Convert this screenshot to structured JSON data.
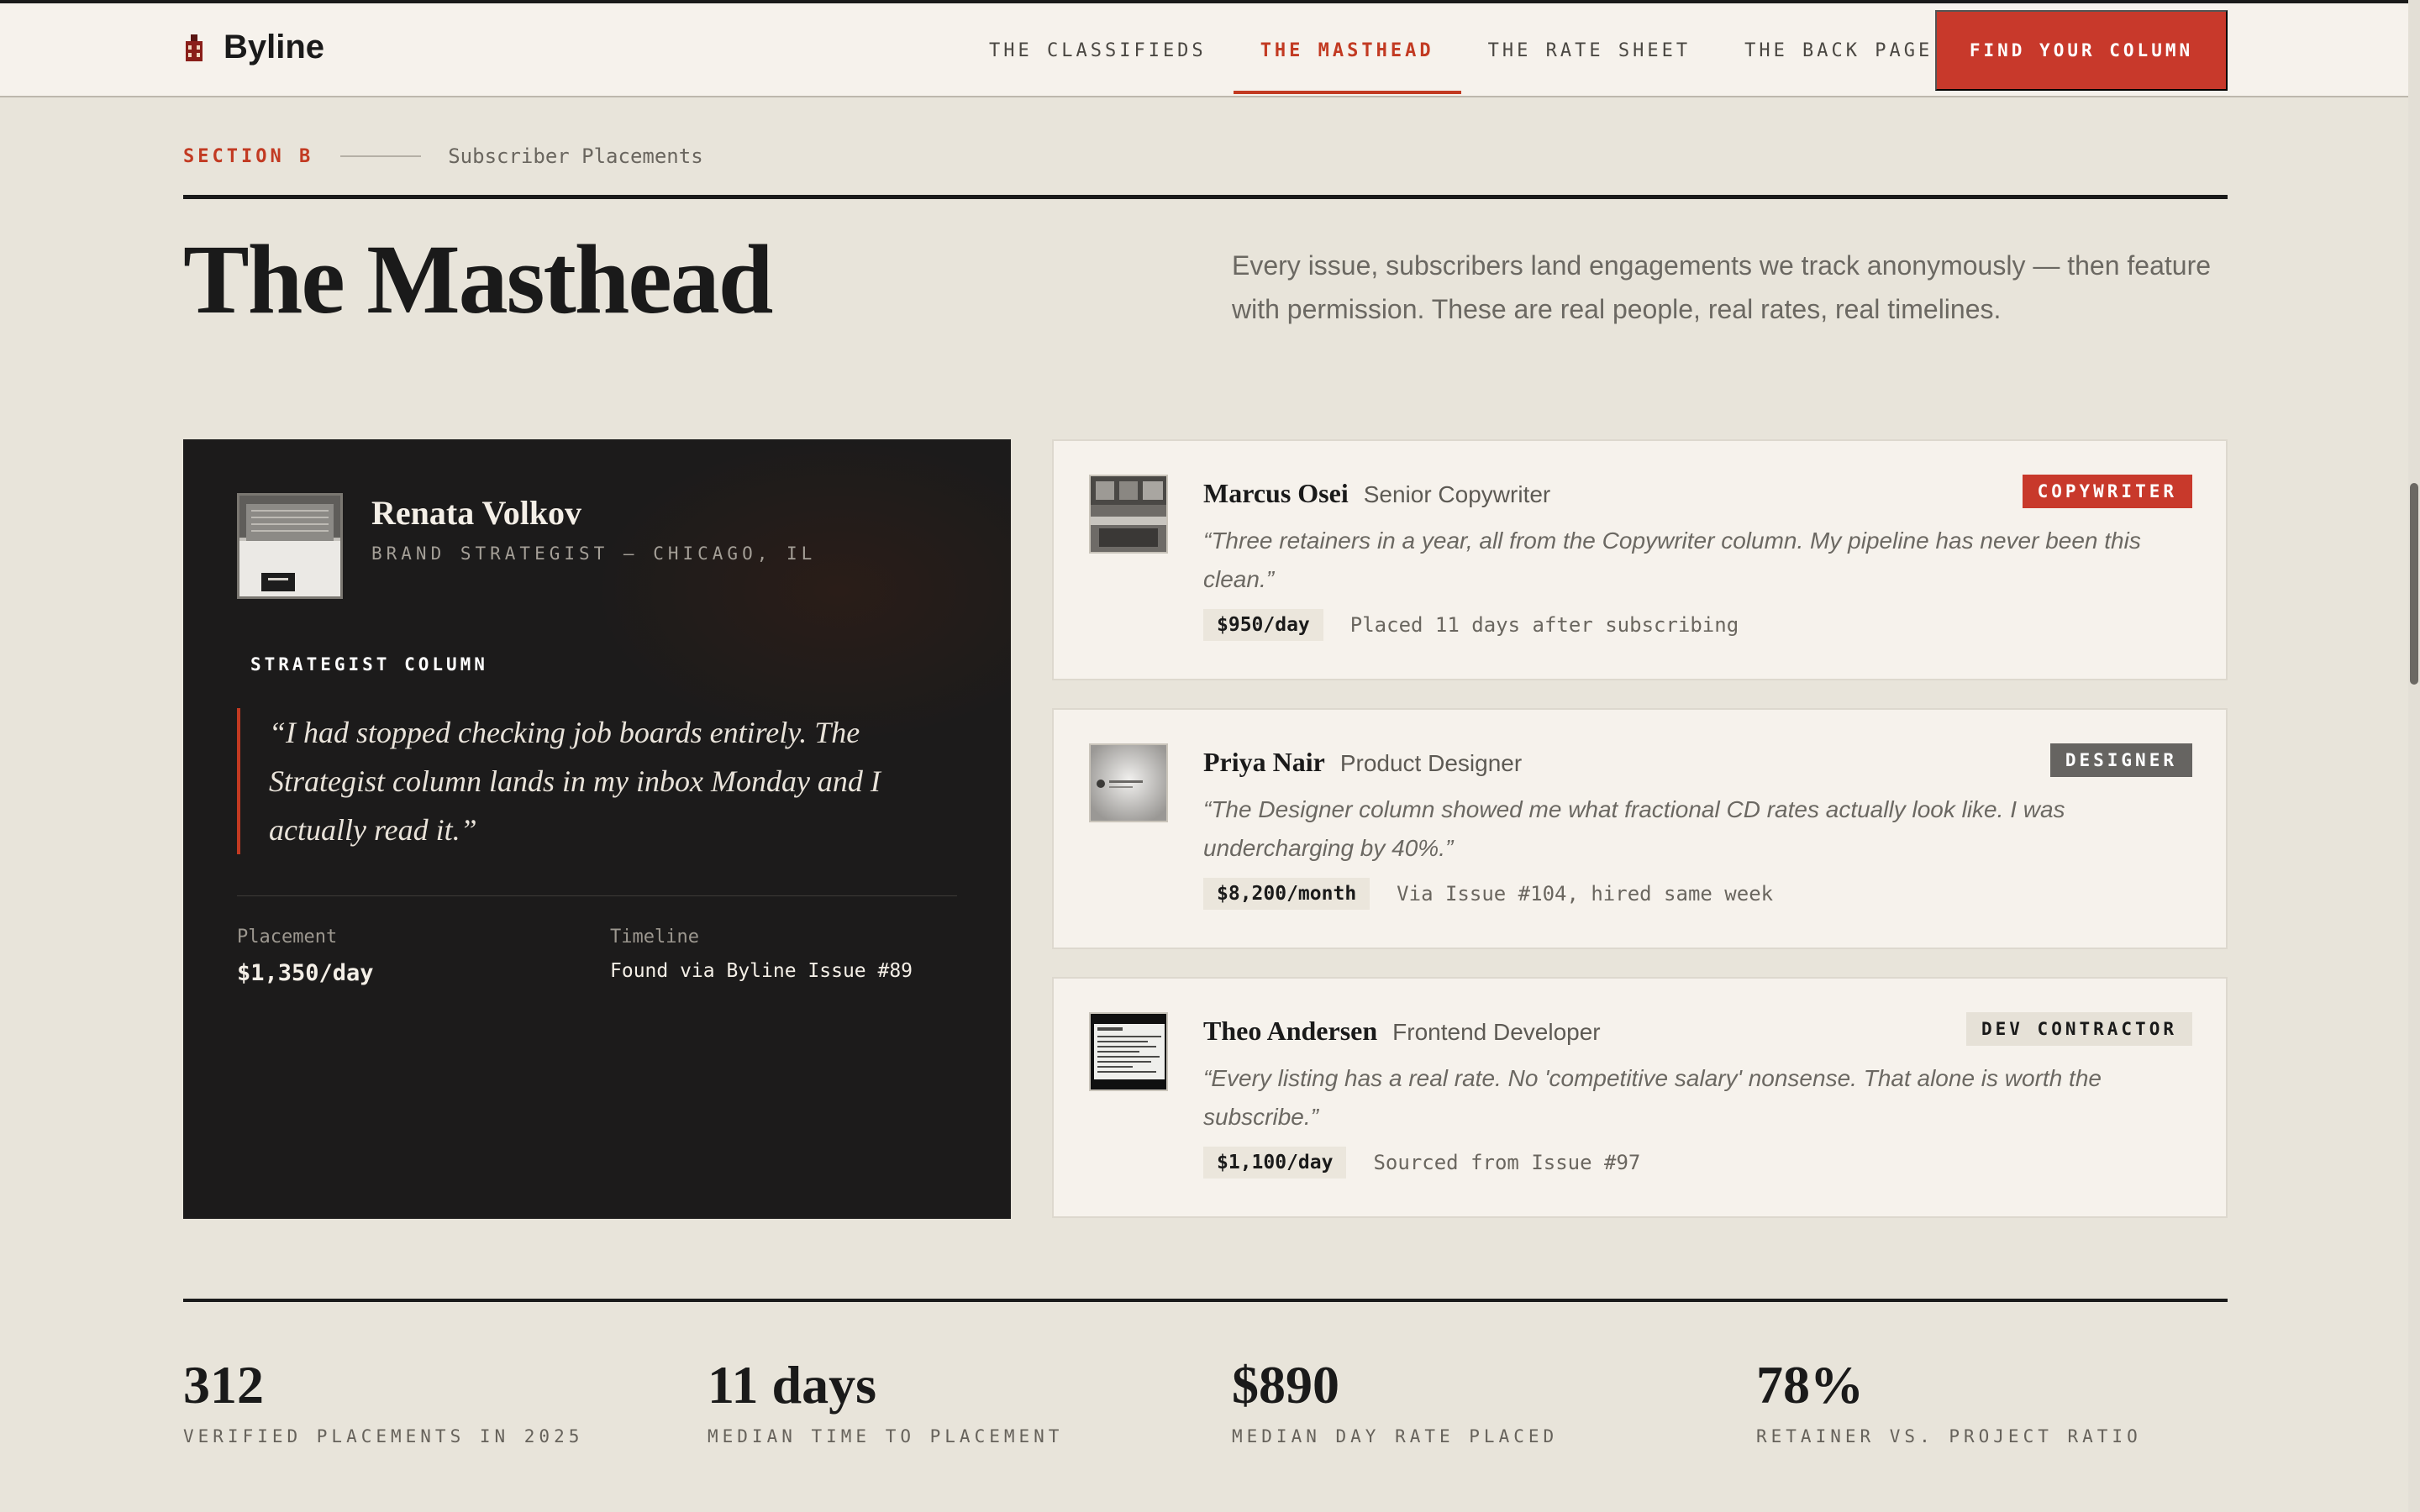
{
  "brand": {
    "name": "Byline",
    "icon": "building-icon"
  },
  "nav": {
    "links": [
      "THE CLASSIFIEDS",
      "THE MASTHEAD",
      "THE RATE SHEET",
      "THE BACK PAGE"
    ],
    "active": "THE MASTHEAD",
    "cta": "FIND YOUR COLUMN"
  },
  "section": {
    "label": "SECTION B",
    "sub": "Subscriber Placements"
  },
  "page": {
    "title": "The Masthead",
    "intro": "Every issue, subscribers land engagements we track anonymously — then feature with permission. These are real people, real rates, real timelines."
  },
  "feature": {
    "name": "Renata Volkov",
    "role": "BRAND STRATEGIST — CHICAGO, IL",
    "column": "STRATEGIST COLUMN",
    "quote": "“I had stopped checking job boards entirely. The Strategist column lands in my inbox Monday and I actually read it.”",
    "placement_label": "Placement",
    "placement_value": "$1,350/day",
    "timeline_label": "Timeline",
    "timeline_value": "Found via Byline Issue #89"
  },
  "testimonials": [
    {
      "name": "Marcus Osei",
      "role": "Senior Copywriter",
      "badge": "COPYWRITER",
      "quote": "“Three retainers in a year, all from the Copywriter column. My pipeline has never been this clean.”",
      "rate": "$950/day",
      "note": "Placed 11 days after subscribing"
    },
    {
      "name": "Priya Nair",
      "role": "Product Designer",
      "badge": "DESIGNER",
      "quote": "“The Designer column showed me what fractional CD rates actually look like. I was undercharging by 40%.”",
      "rate": "$8,200/month",
      "note": "Via Issue #104, hired same week"
    },
    {
      "name": "Theo Andersen",
      "role": "Frontend Developer",
      "badge": "DEV CONTRACTOR",
      "quote": "“Every listing has a real rate. No 'competitive salary' nonsense. That alone is worth the subscribe.”",
      "rate": "$1,100/day",
      "note": "Sourced from Issue #97"
    }
  ],
  "stats": [
    {
      "value": "312",
      "label": "VERIFIED PLACEMENTS IN 2025"
    },
    {
      "value": "11 days",
      "label": "MEDIAN TIME TO PLACEMENT"
    },
    {
      "value": "$890",
      "label": "MEDIAN DAY RATE PLACED"
    },
    {
      "value": "78%",
      "label": "RETAINER VS. PROJECT RATIO"
    }
  ],
  "colors": {
    "accent": "#c8392b",
    "background": "#e8e4da",
    "card": "#f6f2ec",
    "dark": "#1c1b1b"
  }
}
